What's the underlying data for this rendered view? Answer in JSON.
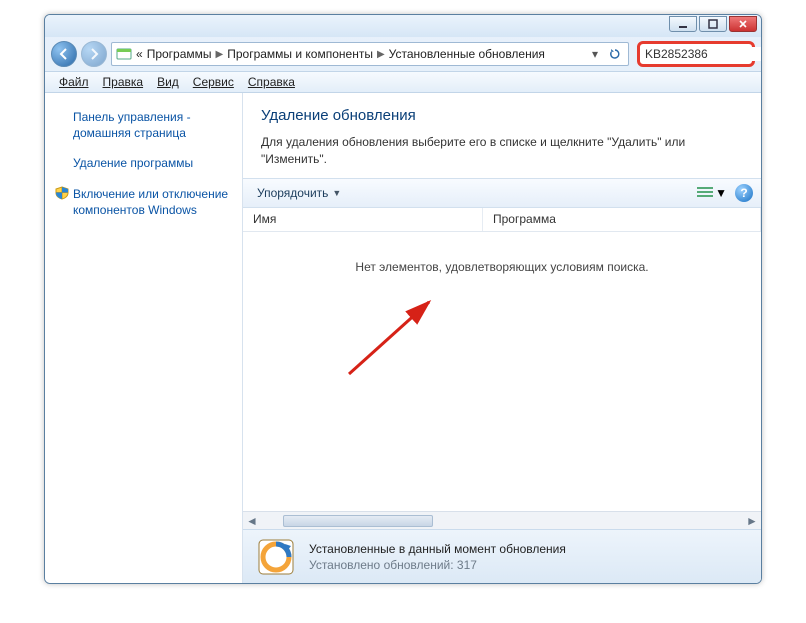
{
  "breadcrumbs": {
    "prefix": "«",
    "items": [
      "Программы",
      "Программы и компоненты",
      "Установленные обновления"
    ]
  },
  "search": {
    "value": "KB2852386"
  },
  "menu": [
    "Файл",
    "Правка",
    "Вид",
    "Сервис",
    "Справка"
  ],
  "sidebar": {
    "items": [
      {
        "label": "Панель управления - домашняя страница"
      },
      {
        "label": "Удаление программы"
      },
      {
        "label": "Включение или отключение компонентов Windows",
        "shield": true
      }
    ]
  },
  "main": {
    "heading": "Удаление обновления",
    "desc": "Для удаления обновления выберите его в списке и щелкните \"Удалить\" или \"Изменить\"."
  },
  "toolbar": {
    "organize": "Упорядочить"
  },
  "columns": {
    "name": "Имя",
    "program": "Программа"
  },
  "list": {
    "empty": "Нет элементов, удовлетворяющих условиям поиска."
  },
  "status": {
    "title": "Установленные в данный момент обновления",
    "count_label": "Установлено обновлений: 317"
  }
}
